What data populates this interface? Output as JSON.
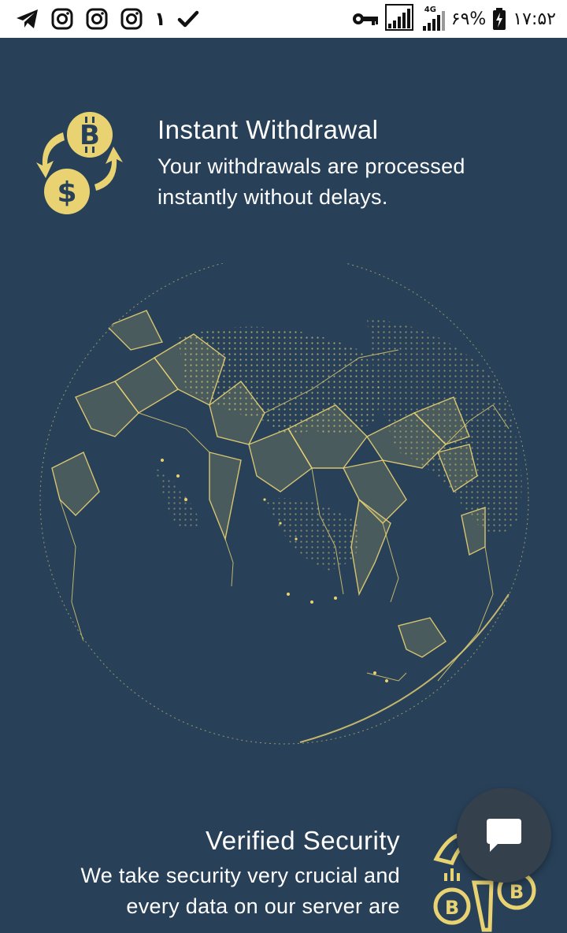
{
  "status_bar": {
    "left_icons": [
      "telegram-icon",
      "instagram-icon",
      "instagram-icon",
      "instagram-icon"
    ],
    "notification_count": "١",
    "check_icon": "check-icon",
    "network_type": "4G",
    "battery": "۶۹%",
    "time": "۱۷:۵۲"
  },
  "features": [
    {
      "icon": "bitcoin-dollar-exchange-icon",
      "title": "Instant Withdrawal",
      "description": "Your withdrawals are processed instantly without delays."
    },
    {
      "icon": "security-bitcoin-icon",
      "title": "Verified Security",
      "description": "We take security very crucial and every data on our server are"
    }
  ],
  "illustration": "world-network-globe",
  "colors": {
    "background": "#284159",
    "accent_gold": "#e8d272",
    "status_bar": "#ffffff",
    "chat_button": "#35404d"
  },
  "chat_button": {
    "icon": "chat-bubble-icon"
  }
}
